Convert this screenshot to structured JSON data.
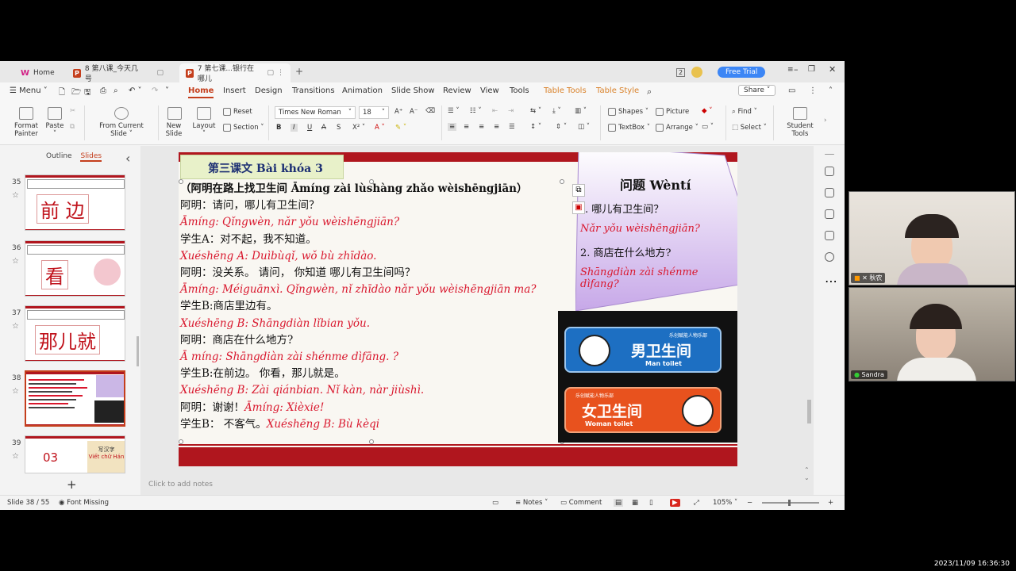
{
  "tabs": [
    {
      "label": "Home"
    },
    {
      "label": "8 第八课_今天几号"
    },
    {
      "label": "7 第七课...银行在哪儿"
    }
  ],
  "titlebar": {
    "badge": "2",
    "free_trial": "Free Trial",
    "share": "Share"
  },
  "menu": {
    "menu_label": "Menu",
    "items": [
      "Home",
      "Insert",
      "Design",
      "Transitions",
      "Animation",
      "Slide Show",
      "Review",
      "View",
      "Tools",
      "Table Tools",
      "Table Style"
    ]
  },
  "ribbon": {
    "format_painter": "Format Painter",
    "paste": "Paste",
    "from_current": "From Current Slide",
    "new_slide": "New Slide",
    "layout": "Layout",
    "reset": "Reset",
    "section": "Section",
    "font_name": "Times New Roman",
    "font_size": "18",
    "shapes": "Shapes",
    "picture": "Picture",
    "textbox": "TextBox",
    "arrange": "Arrange",
    "find": "Find",
    "select": "Select",
    "student_tools": "Student Tools"
  },
  "leftpanel": {
    "outline_tab": "Outline",
    "slides_tab": "Slides",
    "thumbs": [
      {
        "num": "35",
        "chars": "前 边"
      },
      {
        "num": "36",
        "chars": "看"
      },
      {
        "num": "37",
        "chars": "那儿就"
      },
      {
        "num": "38",
        "chars": ""
      },
      {
        "num": "39",
        "chars": "03"
      }
    ],
    "thumb39_label1": "写汉字",
    "thumb39_label2": "Viết chữ Hán"
  },
  "slide": {
    "lesson_title": "第三课文  Bài khóa 3",
    "lines": [
      {
        "t": "hdr",
        "text": "（阿明在路上找卫生间  Āmíng zài lùshàng zhǎo wèishēngjiān）"
      },
      {
        "t": "zh",
        "text": "阿明：请问，哪儿有卫生间？"
      },
      {
        "t": "py",
        "text": "Āmíng: Qǐngwèn, nǎr yǒu wèishēngjiān?"
      },
      {
        "t": "zh",
        "text": "学生A：对不起，我不知道。"
      },
      {
        "t": "py",
        "text": "Xuéshēng A: Duìbùqǐ, wǒ bù zhīdào."
      },
      {
        "t": "zh",
        "text": "阿明：没关系。  请问，  你知道 哪儿有卫生间吗？"
      },
      {
        "t": "py",
        "text": "Āmíng: Méiguānxì. Qǐngwèn, nǐ zhīdào nǎr yǒu wèishēngjiān ma?"
      },
      {
        "t": "zh",
        "text": " 学生B:商店里边有。"
      },
      {
        "t": "py",
        "text": "Xuéshēng B: Shāngdiàn lǐbian yǒu."
      },
      {
        "t": "zh",
        "text": "阿明：商店在什么地方?"
      },
      {
        "t": "py",
        "text": "Ā míng: Shāngdiàn zài shénme dìfāng. ?"
      },
      {
        "t": "zh",
        "text": "学生B:在前边。 你看，那儿就是。"
      },
      {
        "t": "py",
        "text": "Xuéshēng B: Zài qiánbian. Nǐ kàn, nàr jiùshì."
      }
    ],
    "line_thanks_zh": "阿明：谢谢！",
    "line_thanks_py": "Āmíng: Xièxie!",
    "line_last_zh": "学生B：  不客气。",
    "line_last_py": "Xuéshēng B: Bù kèqi",
    "question_title": "问题 Wèntí",
    "q1_zh": ". 哪儿有卫生间？",
    "q1_py": "Nǎr yǒu wèishēngjiān?",
    "q2_zh": "2. 商店在什么地方?",
    "q2_py": "Shāngdiàn zài shénme dìfang?",
    "sign_top": "乐创赋能人物乐部",
    "sign_men": "男卫生间",
    "sign_men_en": "Man toilet",
    "sign_women": "女卫生间",
    "sign_women_en": "Woman toilet"
  },
  "notes_placeholder": "Click to add notes",
  "status": {
    "slide_info": "Slide 38 / 55",
    "font_missing": "Font Missing",
    "notes": "Notes",
    "comment": "Comment",
    "zoom": "105%"
  },
  "participants": [
    {
      "name": "秋农"
    },
    {
      "name": "Sandra"
    }
  ],
  "timestamp": "2023/11/09 16:36:30",
  "colors": {
    "accent": "#c43e1c",
    "slide_red": "#b0161e",
    "pinyin_red": "#d9182e",
    "navy": "#1c2f73"
  }
}
